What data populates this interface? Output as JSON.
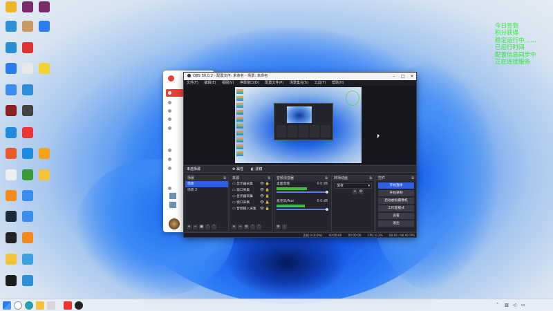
{
  "desktop": {
    "icons": [
      {
        "label": "",
        "color": "#f0b428"
      },
      {
        "label": "",
        "color": "#7a2a6a"
      },
      {
        "label": "",
        "color": "#7a2a6a"
      },
      {
        "label": "",
        "color": "#2a8fd6"
      },
      {
        "label": "",
        "color": "#c89a60"
      },
      {
        "label": "",
        "color": "#2a7cf0"
      },
      {
        "label": "",
        "color": "#2a8fd6"
      },
      {
        "label": "",
        "color": "#d33"
      },
      {
        "label": "",
        "color": "#2a7cf0"
      },
      {
        "label": "",
        "color": "#e8e8e8"
      },
      {
        "label": "",
        "color": "#f2d232"
      },
      {
        "label": "",
        "color": "#3b8ef0"
      },
      {
        "label": "",
        "color": "#2a8fd6"
      },
      {
        "label": "",
        "color": "#8a1f1f"
      },
      {
        "label": "",
        "color": "#444"
      },
      {
        "label": "",
        "color": "#1f8be0"
      },
      {
        "label": "",
        "color": "#e33"
      },
      {
        "label": "",
        "color": "#e85a2a"
      },
      {
        "label": "",
        "color": "#1f8be0"
      },
      {
        "label": "",
        "color": "#f4a21c"
      },
      {
        "label": "",
        "color": "#eee"
      },
      {
        "label": "",
        "color": "#3a9a3a"
      },
      {
        "label": "",
        "color": "#f2c33a"
      },
      {
        "label": "",
        "color": "#f28a1c"
      },
      {
        "label": "",
        "color": "#3b8ef0"
      },
      {
        "label": "",
        "color": "#1b2838"
      },
      {
        "label": "",
        "color": "#3b8ef0"
      },
      {
        "label": "",
        "color": "#222"
      },
      {
        "label": "",
        "color": "#f28a1c"
      },
      {
        "label": "",
        "color": "#f2c33a"
      },
      {
        "label": "",
        "color": "#3aa0e0"
      },
      {
        "label": "",
        "color": "#1c1c1c"
      },
      {
        "label": "",
        "color": "#2a8fd6"
      },
      {
        "label": "",
        "color": "#0b4a6a"
      },
      {
        "label": "",
        "color": "#556"
      }
    ]
  },
  "overlay_lines": [
    "今日签到",
    "积分获得",
    "稳定运行中……",
    "已运行时间",
    "配置信息同步中",
    "正在连接服务"
  ],
  "browser": {
    "items": [
      "",
      "",
      "",
      "",
      "",
      "",
      "",
      "",
      ""
    ],
    "selected_label": ""
  },
  "obs": {
    "title": "OBS 30.0.2 - 配置文件: 未命名 - 场景: 未命名",
    "menu": [
      "文件(F)",
      "编辑(E)",
      "视图(V)",
      "停靠窗口(D)",
      "配置文件(P)",
      "场景集合(S)",
      "工具(T)",
      "帮助(H)"
    ],
    "source_bar": {
      "label": "未选择源",
      "properties": "属性",
      "filters": "滤镜"
    },
    "scenes": {
      "title": "场景",
      "items": [
        "场景",
        "场景 2"
      ]
    },
    "sources": {
      "title": "来源",
      "items": [
        "显示器采集",
        "窗口采集",
        "显示器采集",
        "窗口采集",
        "音频输入采集"
      ]
    },
    "mixer": {
      "title": "音频混音器",
      "channels": [
        {
          "name": "桌面音频",
          "level": "0.0 dB",
          "fill_pct": 60
        },
        {
          "name": "麦克风/Aux",
          "level": "0.0 dB",
          "fill_pct": 55
        }
      ]
    },
    "transitions": {
      "title": "转场动画",
      "selected": "渐变"
    },
    "controls": {
      "title": "控件",
      "buttons": [
        "开始直播",
        "开始录制",
        "启动虚拟摄像机",
        "工作室模式",
        "设置",
        "退出"
      ]
    },
    "status": [
      "丢帧 0 (0.0%)",
      "00:00:00",
      "00:00:00",
      "CPU: 0.3%",
      "60.00 / 60.00 FPS"
    ]
  },
  "taskbar": {
    "icons": [
      "start-icon",
      "search-icon",
      "edge-icon",
      "explorer-icon",
      "app-icon",
      "app-icon",
      "obs-icon"
    ],
    "clock_time": "",
    "clock_date": ""
  }
}
